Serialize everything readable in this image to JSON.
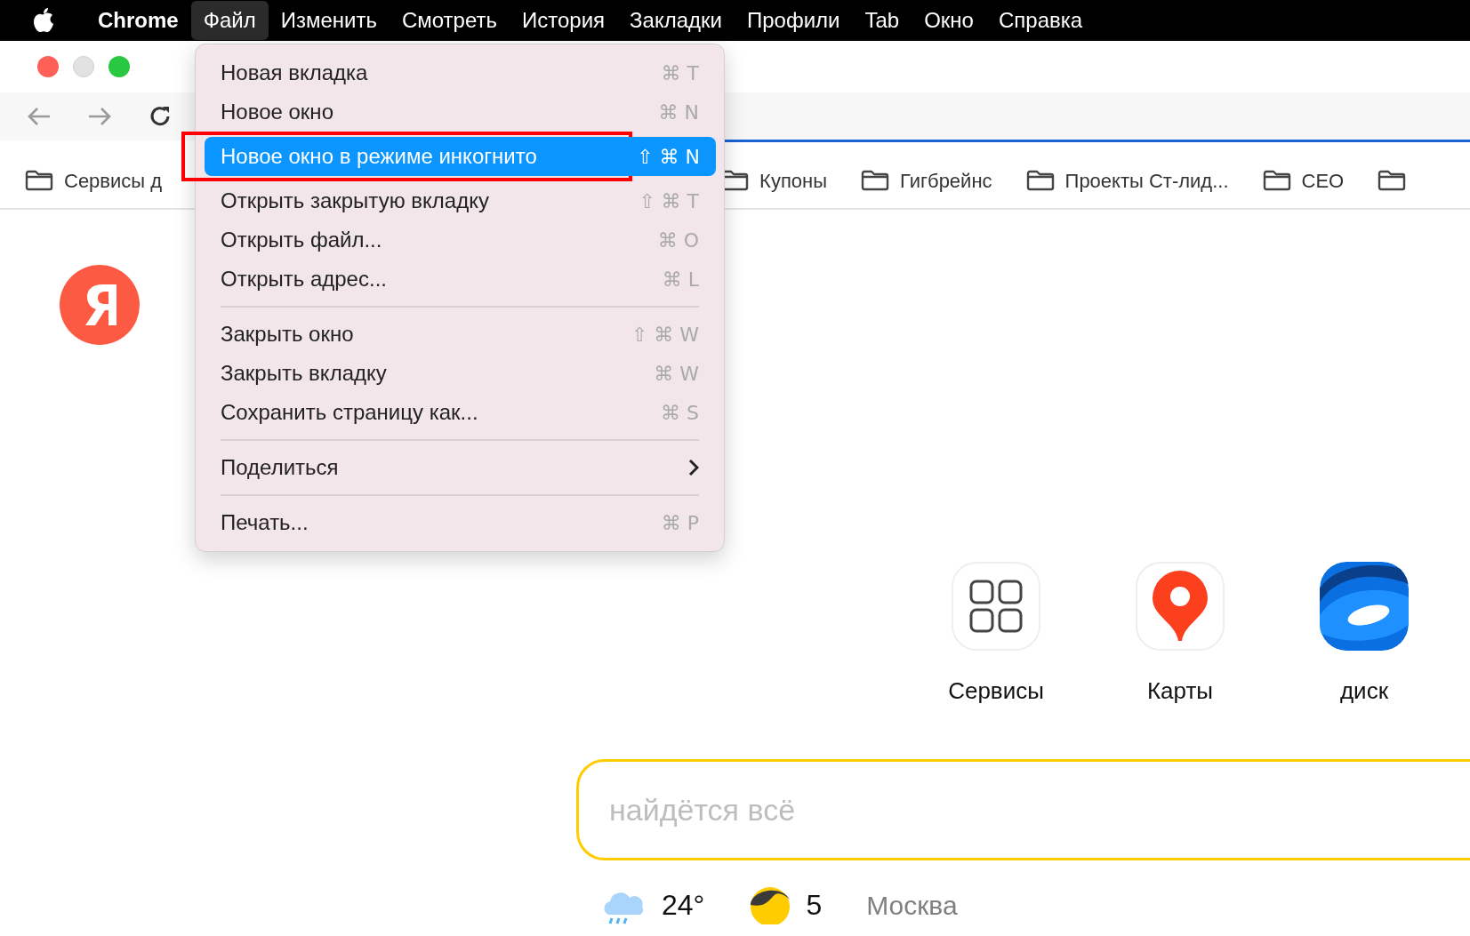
{
  "menu_bar": [
    {
      "label": "Chrome",
      "kind": "app",
      "selected": false
    },
    {
      "label": "Файл",
      "kind": "menu",
      "selected": true
    },
    {
      "label": "Изменить",
      "kind": "menu",
      "selected": false
    },
    {
      "label": "Смотреть",
      "kind": "menu",
      "selected": false
    },
    {
      "label": "История",
      "kind": "menu",
      "selected": false
    },
    {
      "label": "Закладки",
      "kind": "menu",
      "selected": false
    },
    {
      "label": "Профили",
      "kind": "menu",
      "selected": false
    },
    {
      "label": "Tab",
      "kind": "menu",
      "selected": false
    },
    {
      "label": "Окно",
      "kind": "menu",
      "selected": false
    },
    {
      "label": "Справка",
      "kind": "menu",
      "selected": false
    }
  ],
  "bookmarks_left": [
    {
      "label": "Сервисы д"
    }
  ],
  "bookmarks_right": [
    {
      "label": "Купоны"
    },
    {
      "label": "Гигбрейнс"
    },
    {
      "label": "Проекты Ст-лид..."
    },
    {
      "label": "CEO"
    },
    {
      "kind": "folder_only"
    }
  ],
  "file_menu": [
    {
      "kind": "item",
      "label": "Новая вкладка",
      "shortcut": "⌘ T",
      "selected": false
    },
    {
      "kind": "item",
      "label": "Новое окно",
      "shortcut": "⌘ N",
      "selected": false
    },
    {
      "kind": "item",
      "label": "Новое окно в режиме инкогнито",
      "shortcut": "⇧ ⌘ N",
      "selected": true
    },
    {
      "kind": "item",
      "label": "Открыть закрытую вкладку",
      "shortcut": "⇧ ⌘ T",
      "selected": false
    },
    {
      "kind": "item",
      "label": "Открыть файл...",
      "shortcut": "⌘ O",
      "selected": false
    },
    {
      "kind": "item",
      "label": "Открыть адрес...",
      "shortcut": "⌘ L",
      "selected": false
    },
    {
      "kind": "separator"
    },
    {
      "kind": "item",
      "label": "Закрыть окно",
      "shortcut": "⇧ ⌘ W",
      "selected": false
    },
    {
      "kind": "item",
      "label": "Закрыть вкладку",
      "shortcut": "⌘ W",
      "selected": false
    },
    {
      "kind": "item",
      "label": "Сохранить страницу как...",
      "shortcut": "⌘ S",
      "selected": false
    },
    {
      "kind": "separator"
    },
    {
      "kind": "submenu",
      "label": "Поделиться",
      "selected": false
    },
    {
      "kind": "separator"
    },
    {
      "kind": "item",
      "label": "Печать...",
      "shortcut": "⌘ P",
      "selected": false
    }
  ],
  "tiles": [
    {
      "label": "Сервисы",
      "kind": "services"
    },
    {
      "label": "Карты",
      "kind": "maps"
    },
    {
      "label": "диск",
      "kind": "disk"
    }
  ],
  "search": {
    "placeholder": "найдётся всё"
  },
  "weather": {
    "temperature": "24°",
    "magnetic": "5",
    "city": "Москва"
  }
}
